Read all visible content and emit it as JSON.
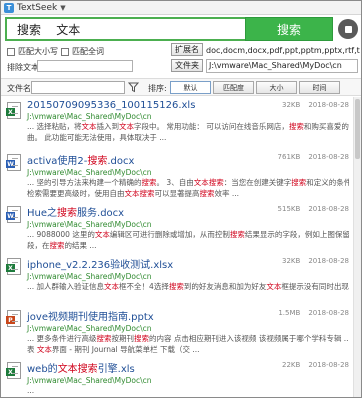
{
  "window": {
    "title": "TextSeek"
  },
  "search": {
    "query": "搜索    文本",
    "button_label": "搜索"
  },
  "options": {
    "match_case_label": "匹配大小写",
    "match_whole_word_label": "匹配全词",
    "exclude_label": "排除文本:"
  },
  "extensions": {
    "button_label": "扩展名",
    "value": "doc,docm,docx,pdf,ppt,pptm,pptx,rtf,txt,xlsm,xlsx"
  },
  "folder": {
    "button_label": "文件夹",
    "value": "J:\\vmware\\Mac_Shared\\MyDoc\\cn"
  },
  "filter": {
    "filename_label": "文件名:",
    "filename_value": "",
    "sort_label": "排序:",
    "sort_options": [
      "默认",
      "匹配度",
      "大小",
      "时间"
    ]
  },
  "results": [
    {
      "icon_type": "xls",
      "icon_color": "#1e7b3c",
      "title_parts": [
        "20150709095336_100115126.xls"
      ],
      "size": "32KB",
      "date": "2018-08-28",
      "path": "J:\\vmware\\Mac_Shared\\MyDoc\\cn",
      "snippets": [
        [
          "... 选择粘贴，将",
          "文本",
          "插入到",
          "文本",
          "字段中。 常用功能： 可以访问在线音乐网店，",
          "搜索",
          "和购买喜爱的歌"
        ],
        [
          "曲。 此功能可能无法使用，具体取决于 ..."
        ]
      ]
    },
    {
      "icon_type": "doc",
      "icon_color": "#2b5fb4",
      "title_parts": [
        "activa使用2-",
        "搜索",
        ".docx"
      ],
      "size": "761KB",
      "date": "2018-08-28",
      "path": "J:\\vmware\\Mac_Shared\\MyDoc\\cn",
      "snippets": [
        [
          "... 坚的引导方法来构建一个精确的",
          "搜索",
          "。 3、自由",
          "文本搜索",
          "：当您在创建关键字",
          "搜索",
          "和定义的条件进行文件"
        ],
        [
          "检索需要更高级时，使用自由",
          "文本搜索",
          "可以显著提高",
          "搜索",
          "效率 ..."
        ]
      ]
    },
    {
      "icon_type": "doc",
      "icon_color": "#2b5fb4",
      "title_parts": [
        "Hue之",
        "搜索",
        "服务.docx"
      ],
      "size": "515KB",
      "date": "2018-08-28",
      "path": "J:\\vmware\\Mac_Shared\\MyDoc\\cn",
      "snippets": [
        [
          "... 9088000 这里的",
          "文本",
          "编辑区可进行删除或增加，从而控制",
          "搜索",
          "结果显示的字段，例如上图保留的7个字"
        ],
        [
          "段，在",
          "搜索",
          "的结果 ..."
        ]
      ]
    },
    {
      "icon_type": "xls",
      "icon_color": "#1e7b3c",
      "title_parts": [
        "iphone_v2.2.236验收测试.xlsx"
      ],
      "size": "32KB",
      "date": "2018-08-28",
      "path": "J:\\vmware\\Mac_Shared\\MyDoc\\cn",
      "snippets": [
        [
          "... 加人群输入验证信息",
          "文本",
          "框不全！4选择",
          "搜索",
          "到的好友消息和加为好友",
          "文本",
          "框提示没有同时出现在屏幕 ..."
        ]
      ]
    },
    {
      "icon_type": "ppt",
      "icon_color": "#c8461a",
      "title_parts": [
        "jove视频期刊使用指南.pptx"
      ],
      "size": "1.5MB",
      "date": "2018-08-28",
      "path": "J:\\vmware\\Mac_Shared\\MyDoc\\cn",
      "snippets": [
        [
          "... 更多条件进行高级",
          "搜索",
          "按期刊",
          "搜索",
          "的内容 点击相应期刊进入该视频 该视频属于哪个学科专辑 ... 添加到收藏列"
        ],
        [
          "表 ",
          "文本",
          "界面 - 期刊 Journal 导航菜单栏 下载（交 ..."
        ]
      ]
    },
    {
      "icon_type": "xls",
      "icon_color": "#1e7b3c",
      "title_parts": [
        "web的",
        "文本搜索",
        "引擎.xls"
      ],
      "size": "22KB",
      "date": "2018-08-28",
      "path": "J:\\vmware\\Mac_Shared\\MyDoc\\cn",
      "snippets": [
        [
          "..."
        ]
      ]
    }
  ]
}
